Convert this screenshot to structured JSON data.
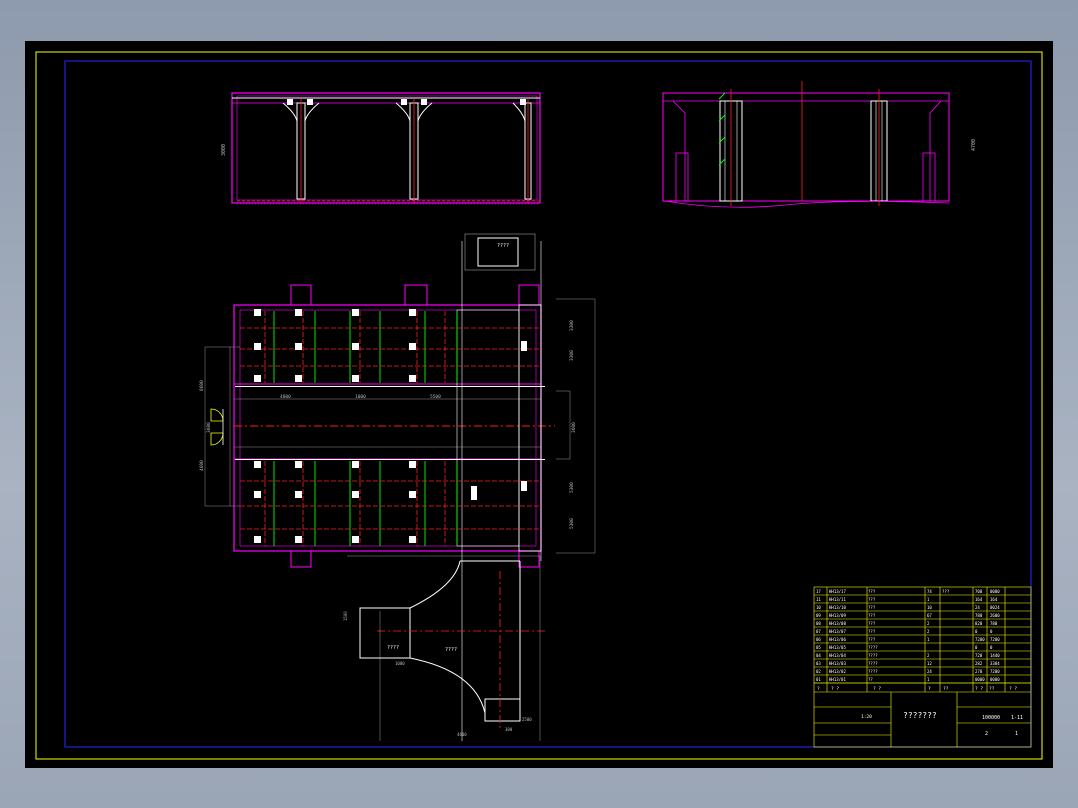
{
  "drawing": {
    "background": "#000000",
    "frame_color": "#ffff00",
    "border_color": "#2222dd",
    "colors": {
      "outline": "#ff00ff",
      "structure": "#ffffff",
      "centerline": "#ff2020",
      "grid": "#00ff00",
      "dimension": "#bbbbbb",
      "table": "#ffff00"
    }
  },
  "views": {
    "front_elevation": {
      "height_dim": "3000"
    },
    "side_elevation": {
      "height_dim": "4700"
    },
    "plan": {
      "dims_left": [
        "8600",
        "3600",
        "4600"
      ],
      "dims_right": [
        "3300",
        "3300",
        "3600",
        "5300",
        "5300"
      ],
      "box_label_top": "????",
      "row_labels": [
        "4800",
        "1000",
        "5500"
      ]
    },
    "detail": {
      "label_a": "????",
      "label_b": "????",
      "dims": [
        "1000",
        "2500",
        "4400",
        "300",
        "1500"
      ]
    }
  },
  "title_block": {
    "parts": [
      {
        "no": "17",
        "code": "HH13/17",
        "name": "???",
        "qty": "74",
        "mat": "???",
        "w1": "700",
        "w2": "0000"
      },
      {
        "no": "11",
        "code": "HH13/11",
        "name": "???",
        "qty": "1",
        "mat": "",
        "w1": "164",
        "w2": "164"
      },
      {
        "no": "10",
        "code": "HH13/10",
        "name": "???",
        "qty": "10",
        "mat": "",
        "w1": "24",
        "w2": "0024"
      },
      {
        "no": "09",
        "code": "HH13/09",
        "name": "???",
        "qty": "67",
        "mat": "",
        "w1": "780",
        "w2": "2600"
      },
      {
        "no": "08",
        "code": "HH13/08",
        "name": "???",
        "qty": "2",
        "mat": "",
        "w1": "820",
        "w2": "780"
      },
      {
        "no": "07",
        "code": "HH13/07",
        "name": "???",
        "qty": "2",
        "mat": "",
        "w1": "0",
        "w2": "0"
      },
      {
        "no": "06",
        "code": "HH13/06",
        "name": "???",
        "qty": "1",
        "mat": "",
        "w1": "7200",
        "w2": "7200"
      },
      {
        "no": "05",
        "code": "HH13/05",
        "name": "????",
        "qty": "",
        "mat": "",
        "w1": "0",
        "w2": "0"
      },
      {
        "no": "04",
        "code": "HH13/04",
        "name": "????",
        "qty": "2",
        "mat": "",
        "w1": "720",
        "w2": "1440"
      },
      {
        "no": "03",
        "code": "HH13/03",
        "name": "????",
        "qty": "12",
        "mat": "",
        "w1": "282",
        "w2": "3384"
      },
      {
        "no": "02",
        "code": "HH13/02",
        "name": "????",
        "qty": "24",
        "mat": "",
        "w1": "270",
        "w2": "7200"
      },
      {
        "no": "01",
        "code": "HH13/01",
        "name": "??",
        "qty": "1",
        "mat": "",
        "w1": "0000",
        "w2": "0000"
      }
    ],
    "header": [
      "?",
      "? ?",
      "? ?",
      "?",
      "??",
      "? ?",
      "??",
      "? ?"
    ],
    "drawing_title": "???????",
    "scale": "1:20",
    "number": "100000",
    "sheet": "1-11",
    "page": "1",
    "pages": "2"
  }
}
